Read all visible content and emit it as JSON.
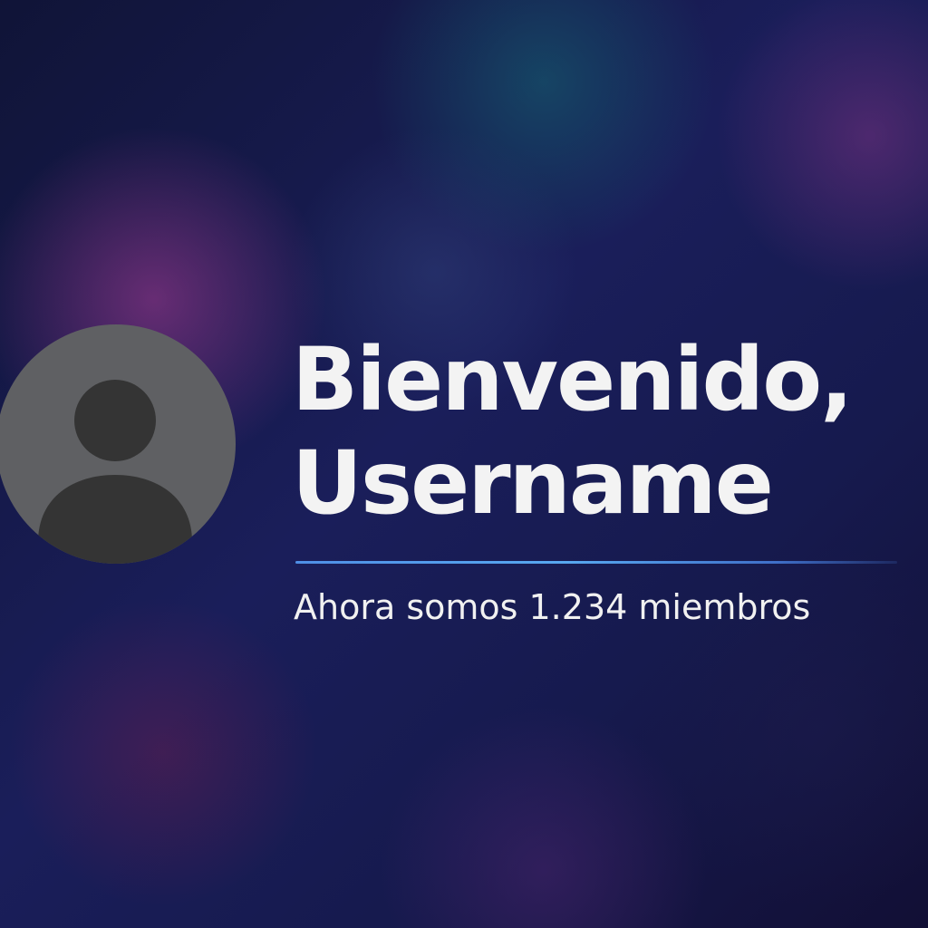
{
  "welcome": {
    "greeting_line": "Bienvenido,",
    "username": "Username",
    "member_message": "Ahora somos 1.234 miembros"
  },
  "avatar": {
    "icon": "default-user-avatar-icon",
    "background_color": "#5f6063",
    "figure_color": "#343434"
  },
  "colors": {
    "text": "#f3f3f3",
    "divider_accent": "#58a8f0",
    "background": "#141642"
  }
}
